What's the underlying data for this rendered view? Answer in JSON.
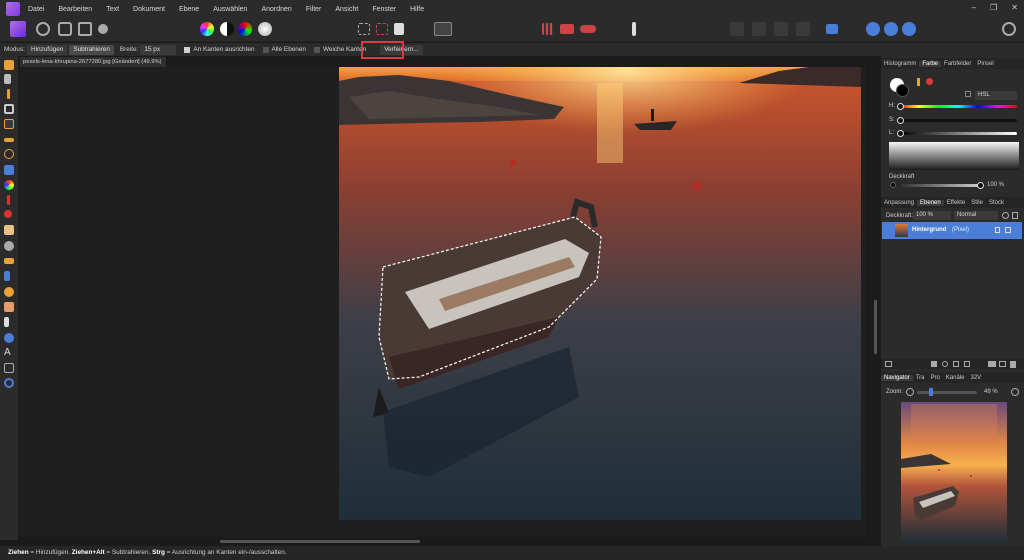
{
  "menu": [
    "Datei",
    "Bearbeiten",
    "Text",
    "Dokument",
    "Ebene",
    "Auswählen",
    "Anordnen",
    "Filter",
    "Ansicht",
    "Fenster",
    "Hilfe"
  ],
  "window_controls": [
    "–",
    "❐",
    "✕"
  ],
  "context": {
    "mode_label": "Modus:",
    "add_label": "Hinzufügen",
    "subtract_label": "Subtrahieren",
    "width_label": "Breite:",
    "width_value": "15 px",
    "snap_edges_label": "An Kanten ausrichten",
    "all_layers_label": "Alle Ebenen",
    "soft_edges_label": "Weiche Kanten",
    "refine_label": "Verfeinern..."
  },
  "document": {
    "tab_title": "pexels-lena-khrupina-2677280.jpg [Geändert] (49.9%)"
  },
  "top_panel": {
    "tabs": [
      "Histogramm",
      "Farbe",
      "Farbfelder",
      "Pinsel"
    ],
    "active_tab": "Farbe",
    "model": "HSL",
    "h_label": "H:",
    "s_label": "S:",
    "l_label": "L:",
    "opacity_label": "Deckkraft",
    "opacity_value": "100 %"
  },
  "layers_panel": {
    "tabs": [
      "Anpassung",
      "Ebenen",
      "Effekte",
      "Stile",
      "Stock"
    ],
    "active_tab": "Ebenen",
    "opacity_label": "Deckkraft:",
    "opacity_value": "100 %",
    "blend_mode": "Normal",
    "layer_name": "Hintergrund",
    "layer_type": "(Pixel)"
  },
  "navigator_panel": {
    "tabs": [
      "Navigator",
      "Tra",
      "Pro",
      "Kanäle",
      "32V"
    ],
    "active_tab": "Navigator",
    "zoom_label": "Zoom:",
    "zoom_value": "49 %"
  },
  "status": {
    "k1": "Ziehen",
    "t1": " = Hinzufügen. ",
    "k2": "Ziehen+Alt",
    "t2": " = Subtrahieren. ",
    "k3": "Strg",
    "t3": " = Ausrichtung an Kanten ein-/ausschalten."
  },
  "colors": {
    "accent_blue": "#4a7ed8",
    "highlight_red": "#e0383e",
    "sunset_orange": "#f28a2a"
  }
}
